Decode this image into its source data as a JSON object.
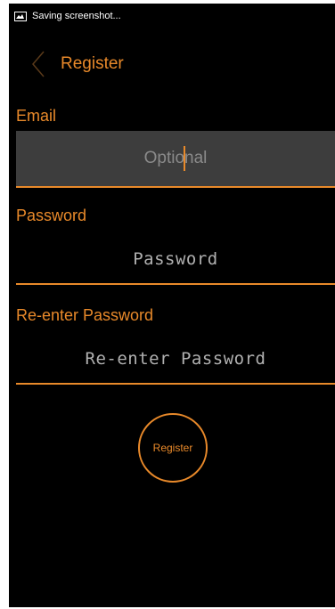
{
  "status_bar": {
    "notification_icon": "image-icon",
    "text": "Saving screenshot..."
  },
  "action_bar": {
    "back_icon": "chevron-left-icon",
    "title": "Register"
  },
  "form": {
    "email": {
      "label": "Email",
      "placeholder": "Optional"
    },
    "password": {
      "label": "Password",
      "placeholder": "Password"
    },
    "reenter_password": {
      "label": "Re-enter Password",
      "placeholder": "Re-enter Password"
    },
    "register_button_label": "Register"
  },
  "colors": {
    "accent": "#e8892a",
    "background": "#000000",
    "focused_field": "#3d3d3d"
  }
}
